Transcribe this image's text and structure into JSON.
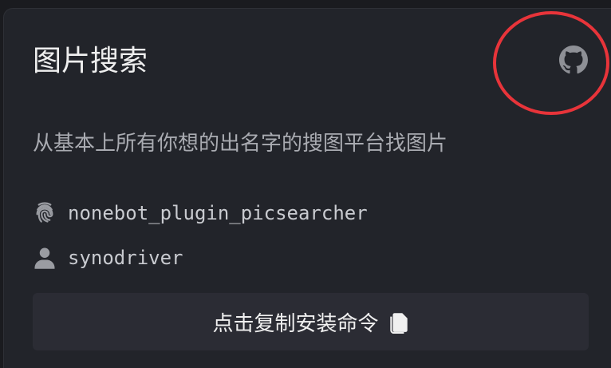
{
  "card": {
    "title": "图片搜索",
    "description": "从基本上所有你想的出名字的搜图平台找图片",
    "plugin_name": "nonebot_plugin_picsearcher",
    "author": "synodriver",
    "copy_button_label": "点击复制安装命令"
  },
  "icons": {
    "repo_link": "github-icon",
    "plugin": "fingerprint-icon",
    "author": "user-icon",
    "copy": "copy-icon"
  },
  "colors": {
    "background": "#1a1b1f",
    "card": "#22242a",
    "button": "#2b2c34",
    "highlight_circle": "#e8343a"
  }
}
